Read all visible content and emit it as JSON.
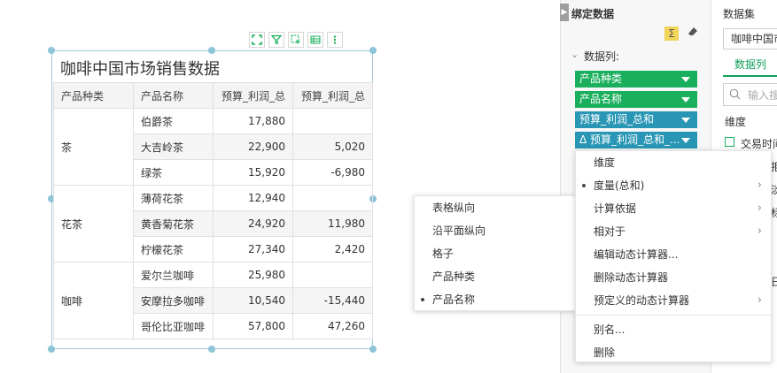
{
  "widget": {
    "title": "咖啡中国市场销售数据",
    "columns": [
      "产品种类",
      "产品名称",
      "预算_利润_总",
      "预算_利润_总"
    ],
    "categories": [
      {
        "name": "茶",
        "rows": [
          {
            "product": "伯爵茶",
            "v1": "17,880",
            "v2": ""
          },
          {
            "product": "大吉岭茶",
            "v1": "22,900",
            "v2": "5,020"
          },
          {
            "product": "绿茶",
            "v1": "15,920",
            "v2": "-6,980"
          }
        ]
      },
      {
        "name": "花茶",
        "rows": [
          {
            "product": "薄荷花茶",
            "v1": "12,940",
            "v2": ""
          },
          {
            "product": "黄香菊花茶",
            "v1": "24,920",
            "v2": "11,980"
          },
          {
            "product": "柠檬花茶",
            "v1": "27,340",
            "v2": "2,420"
          }
        ]
      },
      {
        "name": "咖啡",
        "rows": [
          {
            "product": "爱尔兰咖啡",
            "v1": "25,980",
            "v2": ""
          },
          {
            "product": "安摩拉多咖啡",
            "v1": "10,540",
            "v2": "-15,440"
          },
          {
            "product": "哥伦比亚咖啡",
            "v1": "57,800",
            "v2": "47,260"
          }
        ]
      }
    ]
  },
  "left_menu": {
    "items": [
      "表格纵向",
      "沿平面纵向",
      "格子",
      "产品种类",
      "产品名称"
    ],
    "selected": "产品名称"
  },
  "right_menu": {
    "items": [
      "维度",
      "度量(总和)",
      "计算依据",
      "相对于",
      "编辑动态计算器...",
      "删除动态计算器",
      "预定义的动态计算器",
      "别名...",
      "删除"
    ],
    "selected": "度量(总和)"
  },
  "binding_panel": {
    "title": "绑定数据",
    "section_label": "数据列:",
    "pills": [
      "产品种类",
      "产品名称",
      "预算_利润_总和",
      "预算_利润_总和_..."
    ]
  },
  "dataset_panel": {
    "title": "数据集",
    "dataset_name": "咖啡中国市",
    "tab": "数据列",
    "search_placeholder": "输入搜",
    "dimension_label": "维度",
    "first_item": "交易时间",
    "partial_labels": [
      "拒",
      "淡",
      "标",
      "日"
    ]
  },
  "colors": {
    "green": "#1aaf5d",
    "teal": "#2896b4",
    "accent": "#12a05a"
  }
}
